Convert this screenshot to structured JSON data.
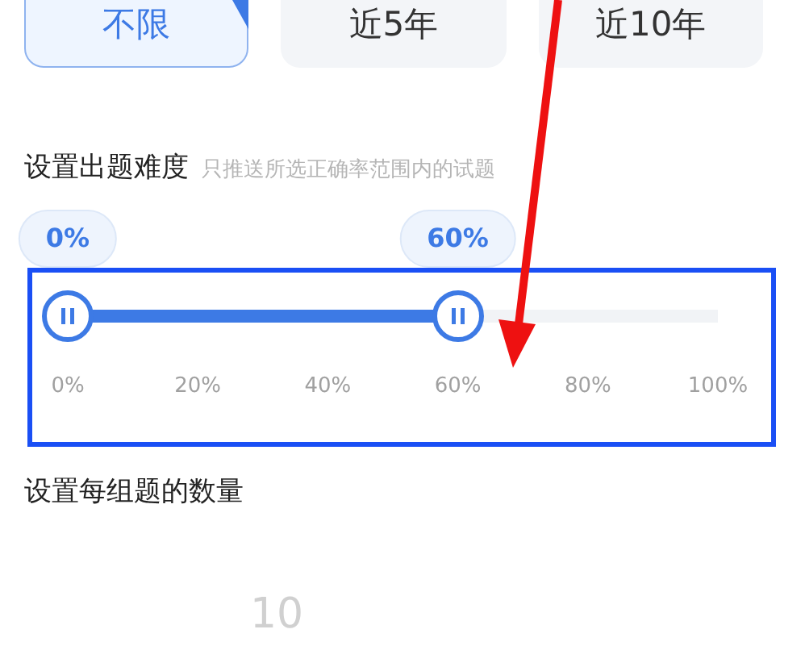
{
  "year_options": [
    {
      "label": "不限",
      "selected": true
    },
    {
      "label": "近5年",
      "selected": false
    },
    {
      "label": "近10年",
      "selected": false
    }
  ],
  "difficulty": {
    "title": "设置出题难度",
    "hint": "只推送所选正确率范围内的试题",
    "thumbs": [
      {
        "label": "0%",
        "level": 0
      },
      {
        "label": "60%",
        "level": 0.6
      }
    ],
    "ticks": [
      "0%",
      "20%",
      "40%",
      "60%",
      "80%",
      "100%"
    ]
  },
  "count": {
    "title": "设置每组题的数量",
    "value": "10"
  }
}
